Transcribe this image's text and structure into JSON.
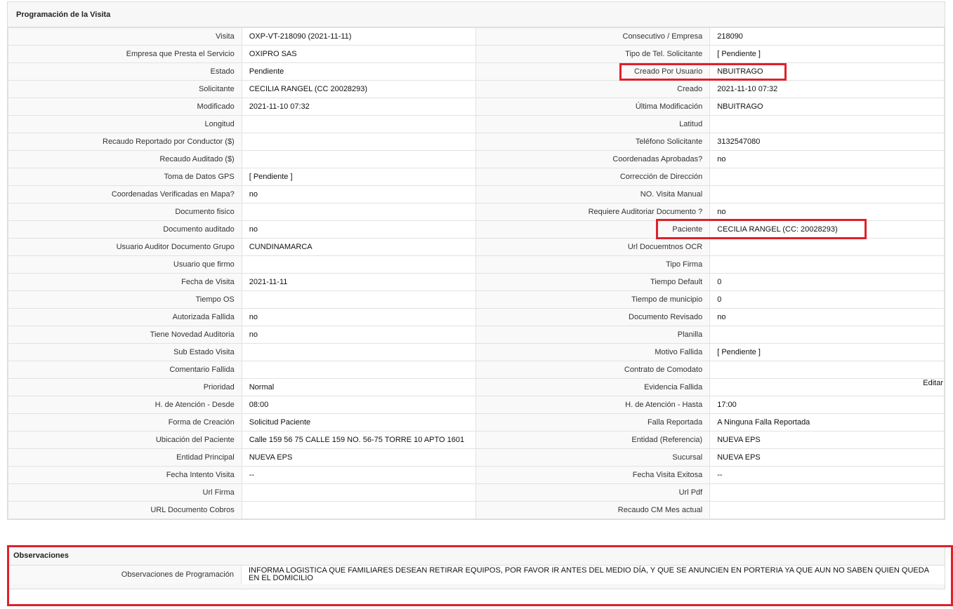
{
  "programacion": {
    "title": "Programación de la Visita",
    "rows": [
      {
        "l1": "Visita",
        "v1": "OXP-VT-218090 (2021-11-11)",
        "l2": "Consecutivo / Empresa",
        "v2": "218090"
      },
      {
        "l1": "Empresa que Presta el Servicio",
        "v1": "OXIPRO SAS",
        "l2": "Tipo de Tel. Solicitante",
        "v2": "[ Pendiente ]"
      },
      {
        "l1": "Estado",
        "v1": "Pendiente",
        "l2": "Creado Por Usuario",
        "v2": "NBUITRAGO"
      },
      {
        "l1": "Solicitante",
        "v1": "CECILIA RANGEL (CC 20028293)",
        "l2": "Creado",
        "v2": "2021-11-10 07:32"
      },
      {
        "l1": "Modificado",
        "v1": "2021-11-10 07:32",
        "l2": "Última Modificación",
        "v2": " NBUITRAGO"
      },
      {
        "l1": "Longitud",
        "v1": "",
        "l2": "Latitud",
        "v2": ""
      },
      {
        "l1": "Recaudo Reportado por Conductor ($)",
        "v1": "",
        "l2": "Teléfono Solicitante",
        "v2": "3132547080"
      },
      {
        "l1": "Recaudo Auditado ($)",
        "v1": "",
        "l2": "Coordenadas Aprobadas?",
        "v2": " no"
      },
      {
        "l1": "Toma de Datos GPS",
        "v1": "[ Pendiente ]",
        "l2": "Corrección de Dirección",
        "v2": ""
      },
      {
        "l1": "Coordenadas Verificadas en Mapa?",
        "v1": " no",
        "l2": "NO. Visita Manual",
        "v2": ""
      },
      {
        "l1": "Documento fisico",
        "v1": "",
        "l2": "Requiere Auditoriar Documento ?",
        "v2": " no"
      },
      {
        "l1": "Documento auditado",
        "v1": " no",
        "l2": "Paciente",
        "v2": "CECILIA RANGEL (CC: 20028293)"
      },
      {
        "l1": "Usuario Auditor Documento Grupo",
        "v1": "CUNDINAMARCA",
        "l2": "Url Docuemtnos OCR",
        "v2": ""
      },
      {
        "l1": "Usuario que firmo",
        "v1": "",
        "l2": "Tipo Firma",
        "v2": ""
      },
      {
        "l1": "Fecha de Visita",
        "v1": " 2021-11-11",
        "l2": "Tiempo Default",
        "v2": "0"
      },
      {
        "l1": "Tiempo OS",
        "v1": "",
        "l2": "Tiempo de municipio",
        "v2": "0"
      },
      {
        "l1": "Autorizada Fallida",
        "v1": " no",
        "l2": "Documento Revisado",
        "v2": " no"
      },
      {
        "l1": "Tiene Novedad Auditoria",
        "v1": " no",
        "l2": "Planilla",
        "v2": ""
      },
      {
        "l1": "Sub Estado Visita",
        "v1": "",
        "l2": "Motivo Fallida",
        "v2": "[ Pendiente ]"
      },
      {
        "l1": "Comentario Fallida",
        "v1": "",
        "l2": "Contrato de Comodato",
        "v2": ""
      },
      {
        "l1": "Prioridad",
        "v1": "Normal",
        "l2": "Evidencia Fallida",
        "v2": ""
      },
      {
        "l1": "H. de Atención - Desde",
        "v1": "08:00",
        "l2": "H. de Atención - Hasta",
        "v2": "17:00"
      },
      {
        "l1": "Forma de Creación",
        "v1": "Solicitud Paciente",
        "l2": "Falla Reportada",
        "v2": "A Ninguna Falla Reportada"
      },
      {
        "l1": "Ubicación del Paciente",
        "v1": "Calle 159 56 75 CALLE 159 NO. 56-75 TORRE 10 APTO 1601",
        "l2": "Entidad (Referencia)",
        "v2": "NUEVA EPS"
      },
      {
        "l1": "Entidad Principal",
        "v1": "NUEVA EPS",
        "l2": "Sucursal",
        "v2": "NUEVA EPS"
      },
      {
        "l1": "Fecha Intento Visita",
        "v1": " --",
        "l2": "Fecha Visita Exitosa",
        "v2": " --"
      },
      {
        "l1": "Url Firma",
        "v1": "",
        "l2": "Url Pdf",
        "v2": ""
      },
      {
        "l1": "URL Documento Cobros",
        "v1": "",
        "l2": "Recaudo CM Mes actual",
        "v2": ""
      }
    ],
    "edit_label": "Editar"
  },
  "observaciones": {
    "title": "Observaciones",
    "label": "Observaciones de Programación",
    "value": "  INFORMA LOGISTICA QUE FAMILIARES DESEAN RETIRAR EQUIPOS, POR FAVOR IR ANTES DEL MEDIO DÍA, Y QUE SE ANUNCIEN EN PORTERIA YA QUE AUN NO SABEN QUIEN QUEDA EN EL DOMICILIO"
  },
  "colors": {
    "highlight": "#e0202a",
    "header_bg": "#f7f7f7",
    "border": "#e2e2e2"
  }
}
